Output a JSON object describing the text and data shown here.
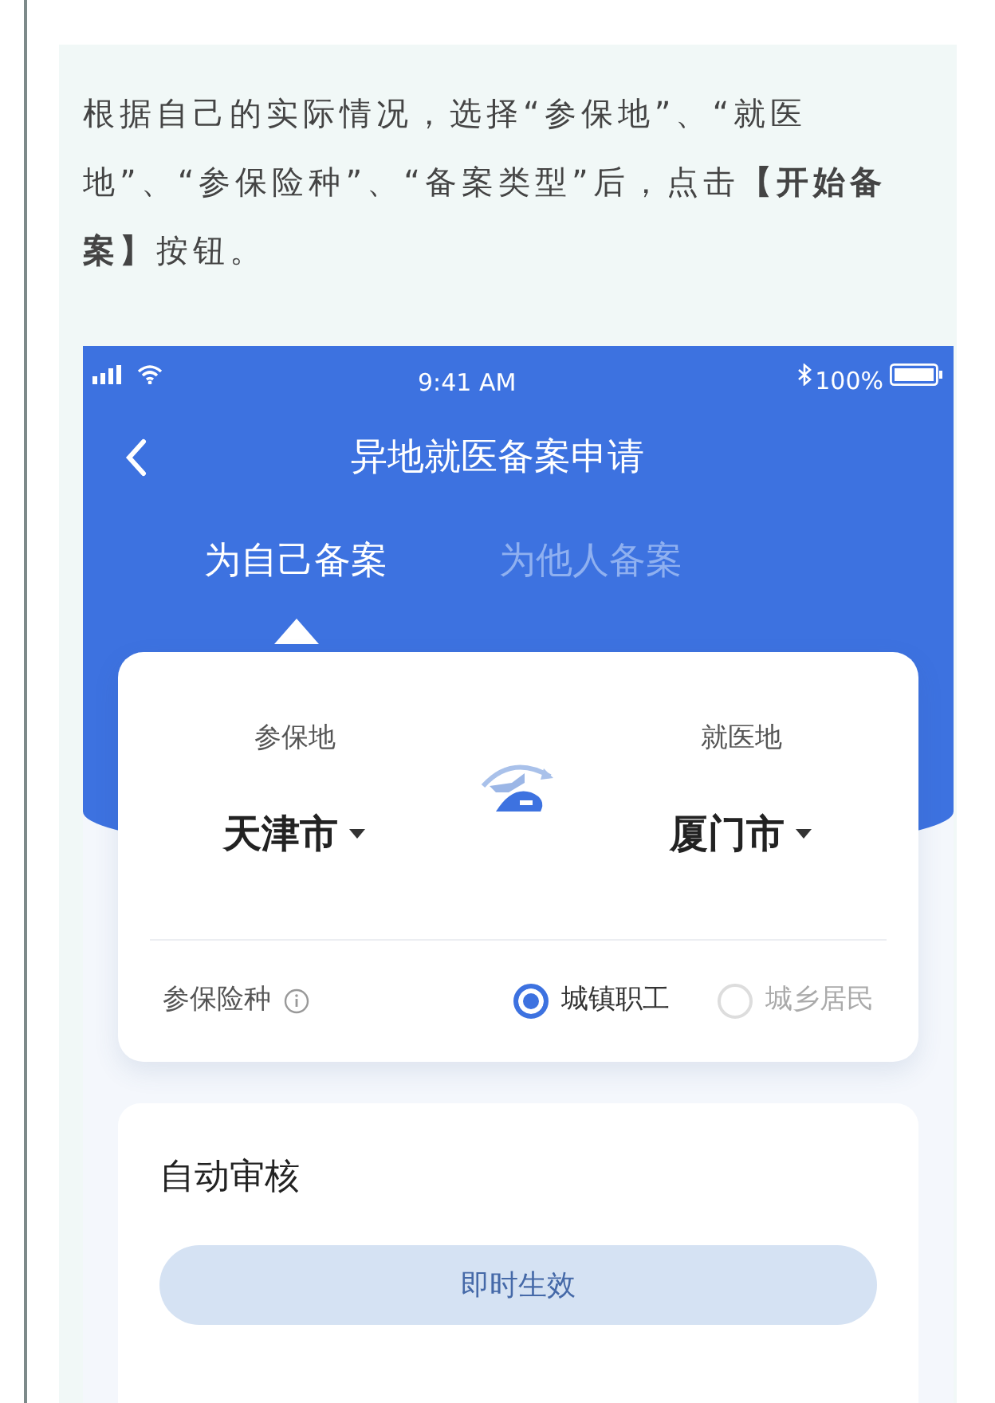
{
  "article": {
    "paragraph": "根据自己的实际情况，选择“参保地”、“就医地”、“参保险种”、“备案类型”后，点击**【开始备案】**按钮。"
  },
  "phone": {
    "status_bar": {
      "time": "9:41 AM",
      "battery": "100%"
    },
    "nav": {
      "title": "异地就医备案申请"
    },
    "tabs": [
      {
        "label": "为自己备案",
        "selected": true
      },
      {
        "label": "为他人备案",
        "selected": false
      }
    ],
    "locations": [
      {
        "label": "参保地",
        "value": "天津市"
      },
      {
        "label": "就医地",
        "value": "厦门市"
      }
    ],
    "insurance": {
      "label": "参保险种",
      "options": [
        {
          "label": "城镇职工",
          "selected": true
        },
        {
          "label": "城乡居民",
          "selected": false
        }
      ]
    },
    "review": {
      "title": "自动审核",
      "button": "即时生效"
    }
  }
}
